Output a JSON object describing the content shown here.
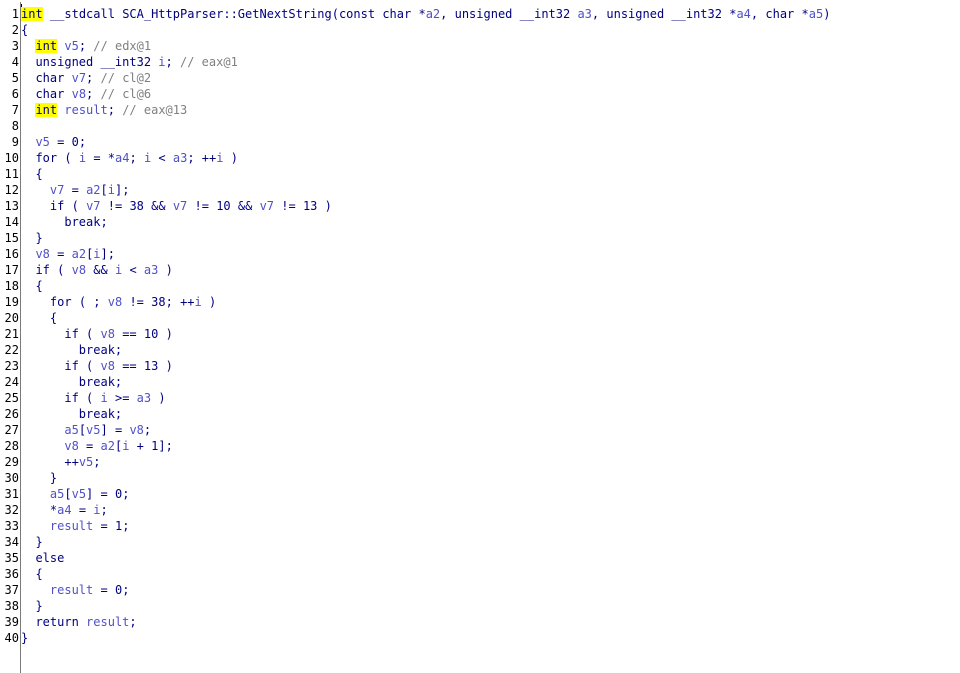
{
  "lines": [
    {
      "n": "1",
      "t": "int __stdcall SCA_HttpParser::GetNextString(const char *a2, unsigned __int32 a3, unsigned __int32 *a4, char *a5)"
    },
    {
      "n": "2",
      "t": "{"
    },
    {
      "n": "3",
      "t": "  int v5; // edx@1"
    },
    {
      "n": "4",
      "t": "  unsigned __int32 i; // eax@1"
    },
    {
      "n": "5",
      "t": "  char v7; // cl@2"
    },
    {
      "n": "6",
      "t": "  char v8; // cl@6"
    },
    {
      "n": "7",
      "t": "  int result; // eax@13"
    },
    {
      "n": "8",
      "t": ""
    },
    {
      "n": "9",
      "t": "  v5 = 0;"
    },
    {
      "n": "10",
      "t": "  for ( i = *a4; i < a3; ++i )"
    },
    {
      "n": "11",
      "t": "  {"
    },
    {
      "n": "12",
      "t": "    v7 = a2[i];"
    },
    {
      "n": "13",
      "t": "    if ( v7 != 38 && v7 != 10 && v7 != 13 )"
    },
    {
      "n": "14",
      "t": "      break;"
    },
    {
      "n": "15",
      "t": "  }"
    },
    {
      "n": "16",
      "t": "  v8 = a2[i];"
    },
    {
      "n": "17",
      "t": "  if ( v8 && i < a3 )"
    },
    {
      "n": "18",
      "t": "  {"
    },
    {
      "n": "19",
      "t": "    for ( ; v8 != 38; ++i )"
    },
    {
      "n": "20",
      "t": "    {"
    },
    {
      "n": "21",
      "t": "      if ( v8 == 10 )"
    },
    {
      "n": "22",
      "t": "        break;"
    },
    {
      "n": "23",
      "t": "      if ( v8 == 13 )"
    },
    {
      "n": "24",
      "t": "        break;"
    },
    {
      "n": "25",
      "t": "      if ( i >= a3 )"
    },
    {
      "n": "26",
      "t": "        break;"
    },
    {
      "n": "27",
      "t": "      a5[v5] = v8;"
    },
    {
      "n": "28",
      "t": "      v8 = a2[i + 1];"
    },
    {
      "n": "29",
      "t": "      ++v5;"
    },
    {
      "n": "30",
      "t": "    }"
    },
    {
      "n": "31",
      "t": "    a5[v5] = 0;"
    },
    {
      "n": "32",
      "t": "    *a4 = i;"
    },
    {
      "n": "33",
      "t": "    result = 1;"
    },
    {
      "n": "34",
      "t": "  }"
    },
    {
      "n": "35",
      "t": "  else"
    },
    {
      "n": "36",
      "t": "  {"
    },
    {
      "n": "37",
      "t": "    result = 0;"
    },
    {
      "n": "38",
      "t": "  }"
    },
    {
      "n": "39",
      "t": "  return result;"
    },
    {
      "n": "40",
      "t": "}"
    }
  ],
  "highlight_word": "int",
  "colors": {
    "keyword": "#000080",
    "variable": "#5050c8",
    "comment": "#808080",
    "highlight": "#ffff00"
  }
}
